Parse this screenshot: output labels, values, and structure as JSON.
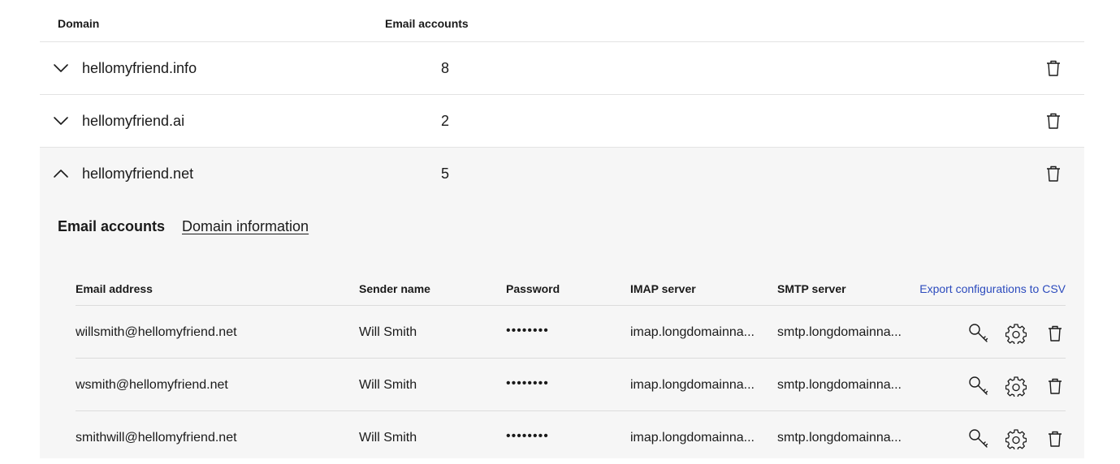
{
  "table": {
    "col_domain": "Domain",
    "col_accounts": "Email accounts"
  },
  "domains": [
    {
      "name": "hellomyfriend.info",
      "count": "8",
      "expanded": false
    },
    {
      "name": "hellomyfriend.ai",
      "count": "2",
      "expanded": false
    },
    {
      "name": "hellomyfriend.net",
      "count": "5",
      "expanded": true
    }
  ],
  "subtabs": {
    "accounts": "Email accounts",
    "info": "Domain information"
  },
  "accounts_table": {
    "col_email": "Email address",
    "col_sender": "Sender name",
    "col_password": "Password",
    "col_imap": "IMAP server",
    "col_smtp": "SMTP server",
    "export_label": "Export configurations to CSV"
  },
  "accounts": [
    {
      "email": "willsmith@hellomyfriend.net",
      "sender": "Will Smith",
      "password": "••••••••",
      "imap": "imap.longdomainna...",
      "smtp": "smtp.longdomainna..."
    },
    {
      "email": "wsmith@hellomyfriend.net",
      "sender": "Will Smith",
      "password": "••••••••",
      "imap": "imap.longdomainna...",
      "smtp": "smtp.longdomainna..."
    },
    {
      "email": "smithwill@hellomyfriend.net",
      "sender": "Will Smith",
      "password": "••••••••",
      "imap": "imap.longdomainna...",
      "smtp": "smtp.longdomainna..."
    }
  ],
  "colors": {
    "accent_link": "#2c4bbd",
    "expanded_bg": "#f6f6f6",
    "divider": "#e3e3e3"
  },
  "icons": {
    "collapsed": "chevron-down-icon",
    "expanded": "chevron-up-icon",
    "delete": "trash-icon",
    "password": "key-icon",
    "settings": "gear-icon"
  }
}
